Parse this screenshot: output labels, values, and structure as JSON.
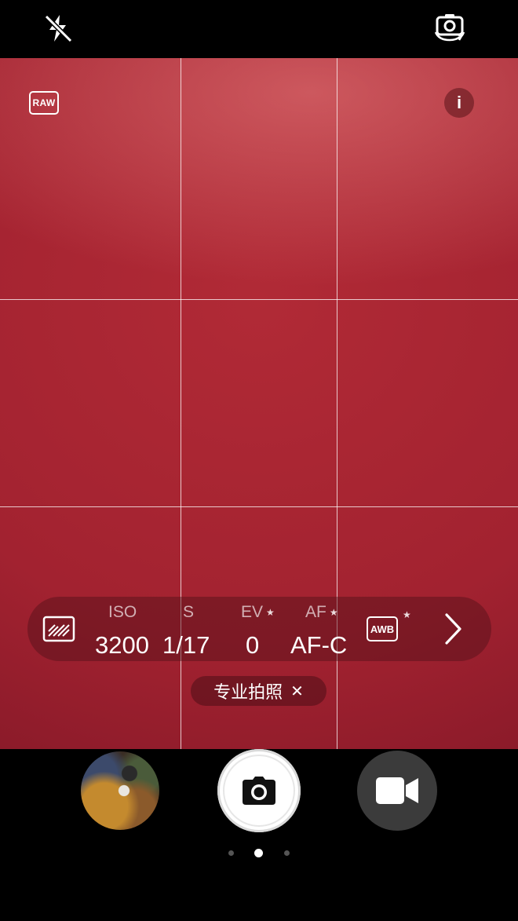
{
  "top_bar": {
    "flash_icon": "flash-off-icon",
    "switch_camera_icon": "switch-camera-icon"
  },
  "viewfinder": {
    "raw_label": "RAW",
    "info_label": "i"
  },
  "pro_settings": {
    "metering_icon": "metering-mode-icon",
    "iso": {
      "label": "ISO",
      "value": "3200"
    },
    "shutter": {
      "label": "S",
      "value": "1/17"
    },
    "ev": {
      "label": "EV",
      "value": "0",
      "star": "★"
    },
    "af": {
      "label": "AF",
      "value": "AF-C",
      "star": "★"
    },
    "awb": {
      "label": "AWB",
      "star": "★"
    },
    "more_icon": "chevron-right-icon"
  },
  "mode_chip": {
    "label": "专业拍照",
    "close": "✕"
  },
  "bottom_bar": {
    "gallery_thumbnail": "gallery-thumbnail",
    "shutter_icon": "camera-icon",
    "video_icon": "video-camera-icon",
    "page_dots": 3,
    "active_dot": 1
  }
}
